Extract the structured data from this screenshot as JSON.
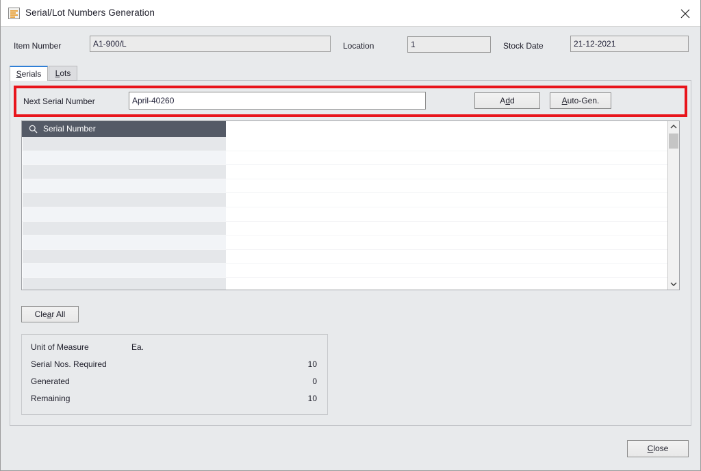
{
  "window": {
    "title": "Serial/Lot Numbers Generation",
    "icon": "document-list-icon",
    "close_icon": "close-icon"
  },
  "header": {
    "item_number_label": "Item Number",
    "item_number_value": "A1-900/L",
    "location_label": "Location",
    "location_value": "1",
    "stock_date_label": "Stock Date",
    "stock_date_value": "21-12-2021"
  },
  "tabs": [
    {
      "label": "Serials",
      "active": true
    },
    {
      "label": "Lots",
      "active": false
    }
  ],
  "serial_entry": {
    "label": "Next Serial Number",
    "value": "April-40260",
    "add_label": "Add",
    "auto_gen_label": "Auto-Gen."
  },
  "grid": {
    "search_icon": "search-icon",
    "column_header": "Serial Number",
    "row_count": 11,
    "rows": []
  },
  "actions": {
    "clear_all_label": "Clear All",
    "close_label": "Close"
  },
  "summary": {
    "rows": [
      {
        "label": "Unit of Measure",
        "value": "Ea.",
        "align": "left"
      },
      {
        "label": "Serial Nos. Required",
        "value": "10",
        "align": "right"
      },
      {
        "label": "Generated",
        "value": "0",
        "align": "right"
      },
      {
        "label": "Remaining",
        "value": "10",
        "align": "right"
      }
    ]
  },
  "highlight": {
    "color": "#e8141b",
    "target": "next-serial-number-row"
  }
}
